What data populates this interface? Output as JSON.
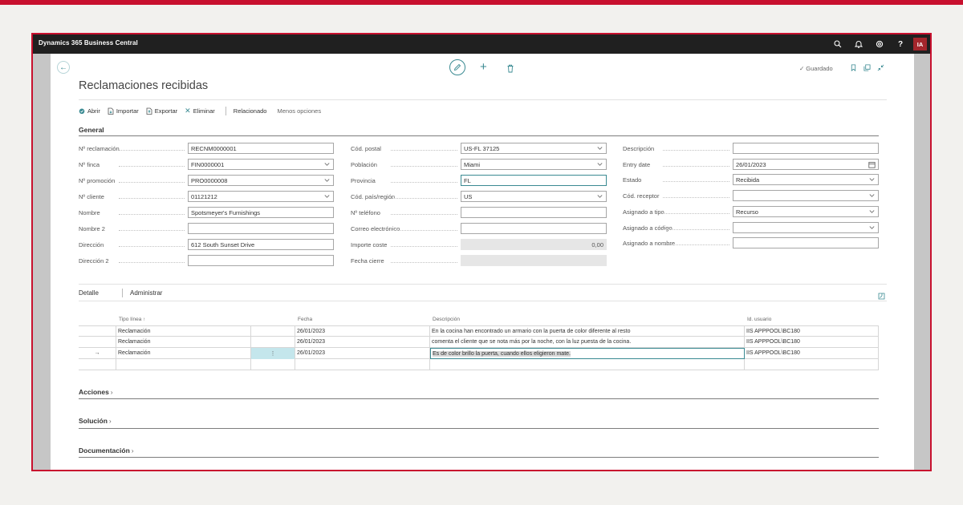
{
  "app": {
    "title": "Dynamics 365 Business Central",
    "avatar_initials": "IA",
    "accent_color": "#c8102e",
    "theme_color": "#3a8a92"
  },
  "page": {
    "title": "Reclamaciones recibidas",
    "save_status": "Guardado"
  },
  "actions": {
    "open": "Abrir",
    "import": "Importar",
    "export": "Exportar",
    "delete": "Eliminar",
    "related": "Relacionado",
    "fewer_options": "Menos opciones"
  },
  "general": {
    "heading": "General",
    "col1": [
      {
        "label": "Nº reclamación",
        "value": "RECNM0000001",
        "dropdown": false
      },
      {
        "label": "Nº finca",
        "value": "FIN0000001",
        "dropdown": true
      },
      {
        "label": "Nº promoción",
        "value": "PRO0000008",
        "dropdown": true
      },
      {
        "label": "Nº cliente",
        "value": "01121212",
        "dropdown": true
      },
      {
        "label": "Nombre",
        "value": "Spotsmeyer's Furnishings",
        "dropdown": false
      },
      {
        "label": "Nombre 2",
        "value": "",
        "dropdown": false
      },
      {
        "label": "Dirección",
        "value": "612 South Sunset Drive",
        "dropdown": false
      },
      {
        "label": "Dirección 2",
        "value": "",
        "dropdown": false
      }
    ],
    "col2": [
      {
        "label": "Cód. postal",
        "value": "US-FL 37125",
        "dropdown": true
      },
      {
        "label": "Población",
        "value": "Miami",
        "dropdown": true
      },
      {
        "label": "Provincia",
        "value": "FL",
        "dropdown": false
      },
      {
        "label": "Cód. país/región",
        "value": "US",
        "dropdown": true
      },
      {
        "label": "Nº teléfono",
        "value": "",
        "dropdown": false
      },
      {
        "label": "Correo electrónico",
        "value": "",
        "dropdown": false
      },
      {
        "label": "Importe coste",
        "value": "0,00",
        "dropdown": false
      },
      {
        "label": "Fecha cierre",
        "value": "",
        "dropdown": false
      }
    ],
    "col3": [
      {
        "label": "Descripción",
        "value": "",
        "dropdown": false
      },
      {
        "label": "Entry date",
        "value": "26/01/2023",
        "dropdown": false
      },
      {
        "label": "Estado",
        "value": "Recibida",
        "dropdown": true
      },
      {
        "label": "Cód. receptor",
        "value": "",
        "dropdown": true
      },
      {
        "label": "Asignado a tipo",
        "value": "Recurso",
        "dropdown": true
      },
      {
        "label": "Asignado a código",
        "value": "",
        "dropdown": true
      },
      {
        "label": "Asignado a nombre",
        "value": "",
        "dropdown": false
      }
    ]
  },
  "detail": {
    "tab_detail": "Detalle",
    "tab_manage": "Administrar",
    "columns": {
      "type": "Tipo línea ↑",
      "date": "Fecha",
      "description": "Descripción",
      "user": "Id. usuario"
    },
    "rows": [
      {
        "marker": "",
        "type": "Reclamación",
        "menu": "",
        "date": "26/01/2023",
        "description": "En la cocina han encontrado un armario con la puerta de color diferente al resto",
        "user": "IIS APPPOOL\\BC180"
      },
      {
        "marker": "",
        "type": "Reclamación",
        "menu": "",
        "date": "26/01/2023",
        "description": "comenta el cliente que se nota más por la noche, con la luz puesta de la cocina.",
        "user": "IIS APPPOOL\\BC180"
      },
      {
        "marker": "→",
        "type": "Reclamación",
        "menu": "⋮",
        "date": "26/01/2023",
        "description": "Es de color brillo la puerta, cuando ellos eligieron mate.",
        "user": "IIS APPPOOL\\BC180"
      }
    ]
  },
  "fasttabs": {
    "actions": "Acciones",
    "solution": "Solución",
    "documentation": "Documentación"
  }
}
